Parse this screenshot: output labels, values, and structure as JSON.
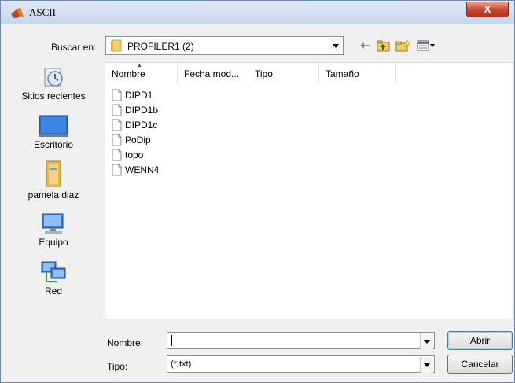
{
  "window": {
    "title": "ASCII",
    "close_label": "X"
  },
  "lookin": {
    "label": "Buscar en:",
    "value": "PROFILER1 (2)"
  },
  "toolbar_icons": [
    "back-arrow-icon",
    "up-folder-icon",
    "new-folder-icon",
    "view-menu-icon"
  ],
  "sidebar": {
    "items": [
      {
        "label": "Sitios recientes",
        "icon": "recent-places-icon"
      },
      {
        "label": "Escritorio",
        "icon": "desktop-icon"
      },
      {
        "label": "pamela diaz",
        "icon": "user-folder-icon"
      },
      {
        "label": "Equipo",
        "icon": "computer-icon"
      },
      {
        "label": "Red",
        "icon": "network-icon"
      }
    ]
  },
  "columns": [
    "Nombre",
    "Fecha mod...",
    "Tipo",
    "Tamaño"
  ],
  "files": [
    "DIPD1",
    "DIPD1b",
    "DIPD1c",
    "PoDip",
    "topo",
    "WENN4"
  ],
  "filename": {
    "label": "Nombre:",
    "value": ""
  },
  "filetype": {
    "label": "Tipo:",
    "value": "(*.txt)"
  },
  "buttons": {
    "open": "Abrir",
    "cancel": "Cancelar"
  },
  "colors": {
    "close_red": "#c7432c",
    "titlebar": "#c6d6ea",
    "folder_yellow": "#e8b84a"
  }
}
